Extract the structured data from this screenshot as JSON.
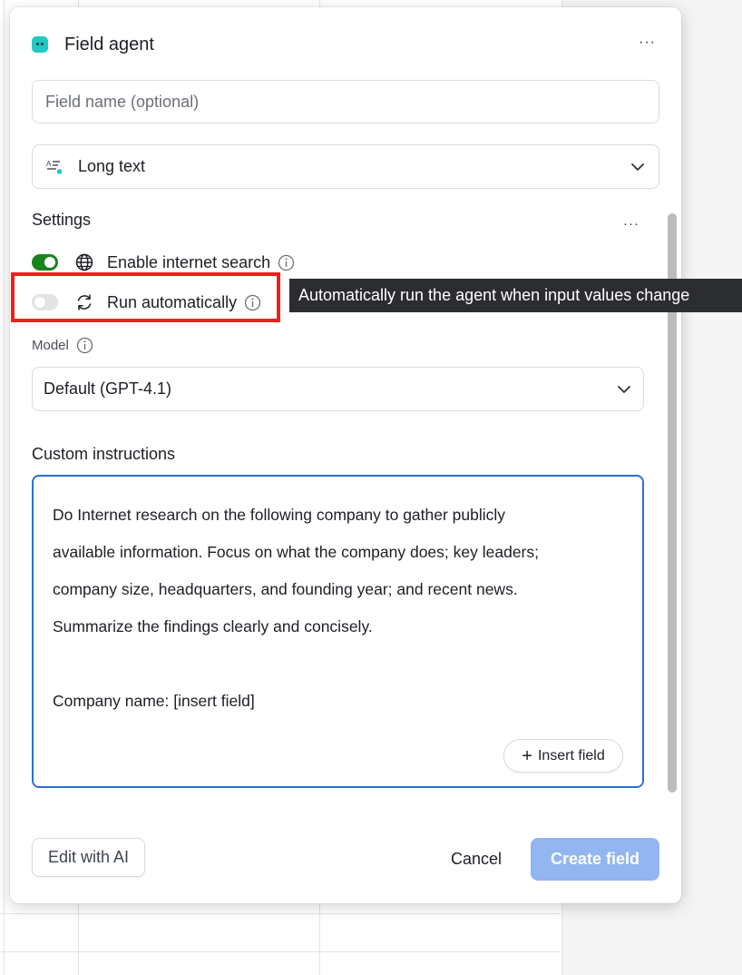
{
  "dialog": {
    "title": "Field agent",
    "more_label": "···"
  },
  "field_name": {
    "placeholder": "Field name (optional)",
    "value": ""
  },
  "field_type": {
    "selected": "Long text",
    "icon": "long-text-icon"
  },
  "settings": {
    "label": "Settings",
    "more_label": "···",
    "internet_search": {
      "label": "Enable internet search",
      "enabled": true,
      "icon": "globe-icon"
    },
    "run_automatically": {
      "label": "Run automatically",
      "enabled": false,
      "icon": "refresh-icon"
    }
  },
  "tooltip": {
    "text": "Automatically run the agent when input values change"
  },
  "model": {
    "label": "Model",
    "selected": "Default (GPT-4.1)"
  },
  "instructions": {
    "label": "Custom instructions",
    "lines": [
      "Do Internet research on the following company to gather publicly",
      "available information. Focus on what the company does; key leaders;",
      "company size, headquarters, and founding year; and recent news.",
      "Summarize the findings clearly and concisely.",
      "",
      "Company name: [insert field]"
    ],
    "insert_button": "Insert field"
  },
  "footer": {
    "edit_with_ai": "Edit with AI",
    "cancel": "Cancel",
    "create": "Create field"
  },
  "colors": {
    "accent": "#2d6fd6",
    "toggle_on": "#18841d",
    "highlight": "#f0201a",
    "create_disabled": "#93b5f0"
  }
}
